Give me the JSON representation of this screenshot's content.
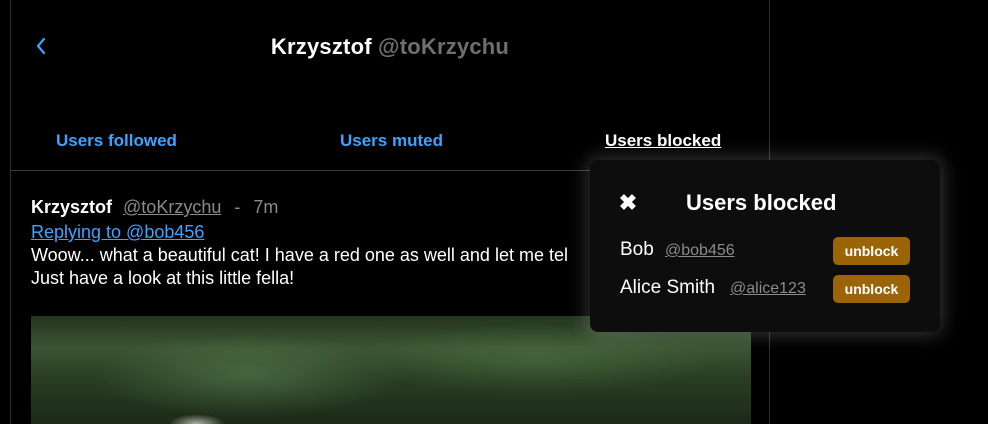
{
  "header": {
    "back_icon": "chevron-left-icon",
    "name": "Krzysztof",
    "handle": "@toKrzychu"
  },
  "tabs": [
    {
      "label": "Users followed",
      "active": false
    },
    {
      "label": "Users muted",
      "active": false
    },
    {
      "label": "Users blocked",
      "active": true
    }
  ],
  "post": {
    "author": "Krzysztof",
    "handle": "@toKrzychu",
    "separator": "-",
    "time": "7m",
    "reply_to": "Replying to @bob456",
    "text": "Woow... what a beautiful cat! I have a red one as well and let me tel\nJust have a look at this little fella!"
  },
  "popup": {
    "close_icon": "close-icon",
    "close_glyph": "✖",
    "title": "Users blocked",
    "users": [
      {
        "name": "Bob",
        "handle": "@bob456",
        "action": "unblock"
      },
      {
        "name": "Alice Smith",
        "handle": "@alice123",
        "action": "unblock"
      }
    ]
  },
  "colors": {
    "background": "#000000",
    "link_blue": "#3ea3ff",
    "muted_gray": "#8a8a8a",
    "unblock_button": "#9a6407"
  }
}
